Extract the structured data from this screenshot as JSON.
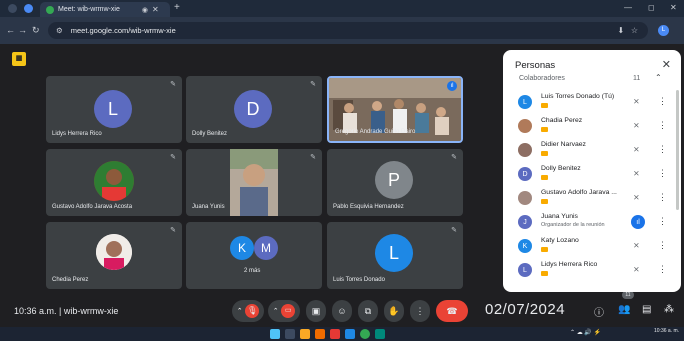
{
  "browser": {
    "tab_title": "Meet: wib-wrmw-xie",
    "url": "meet.google.com/wib-wrmw-xie"
  },
  "tiles": [
    {
      "name": "Lidys Herrera Rico",
      "initial": "L",
      "color": "#5c6bc0"
    },
    {
      "name": "Dolly Benitez",
      "initial": "D",
      "color": "#5c6bc0"
    },
    {
      "name": "Gregorio Andrade Guillo Dairo",
      "initial": "",
      "color": ""
    },
    {
      "name": "Gustavo Adolfo Jarava Acosta",
      "initial": "",
      "color": ""
    },
    {
      "name": "Juana Yunis",
      "initial": "",
      "color": ""
    },
    {
      "name": "Pablo Esquivia Hernandez",
      "initial": "P",
      "color": "#80868b"
    },
    {
      "name": "Chedia Perez",
      "initial": "",
      "color": ""
    },
    {
      "name": "2 más",
      "initial": "",
      "color": ""
    },
    {
      "name": "Luis Torres Donado",
      "initial": "L",
      "color": "#1e88e5"
    }
  ],
  "more_tile": {
    "avatars": [
      "K",
      "M"
    ],
    "label": "2 más"
  },
  "bottom": {
    "time_code": "10:36 a.m.  |  wib-wrmw-xie",
    "date": "02/07/2024",
    "participant_count": "11"
  },
  "panel": {
    "title": "Personas",
    "section": "Colaboradores",
    "section_count": "11",
    "people": [
      {
        "name": "Luis Torres Donado (Tú)",
        "sub": "",
        "initial": "L",
        "color": "#1e88e5",
        "active": false
      },
      {
        "name": "Chadia Perez",
        "sub": "",
        "initial": "",
        "color": "#b07a5a",
        "active": false
      },
      {
        "name": "Didier Narvaez",
        "sub": "",
        "initial": "",
        "color": "#8d6e63",
        "active": false
      },
      {
        "name": "Dolly Benitez",
        "sub": "",
        "initial": "D",
        "color": "#5c6bc0",
        "active": false
      },
      {
        "name": "Gustavo Adolfo Jarava ...",
        "sub": "",
        "initial": "",
        "color": "#a1887f",
        "active": false
      },
      {
        "name": "Juana Yunis",
        "sub": "Organizador de la reunión",
        "initial": "J",
        "color": "#5c6bc0",
        "active": true
      },
      {
        "name": "Katy Lozano",
        "sub": "",
        "initial": "K",
        "color": "#1e88e5",
        "active": false
      },
      {
        "name": "Lidys Herrera Rico",
        "sub": "",
        "initial": "L",
        "color": "#5c6bc0",
        "active": false
      }
    ]
  },
  "taskbar": {
    "clock": "10:36 a. m."
  }
}
